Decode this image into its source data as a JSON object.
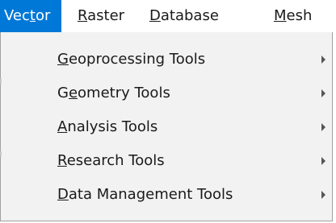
{
  "menubar": {
    "vector": {
      "before": "Vec",
      "mnemonic": "t",
      "after": "or"
    },
    "raster": {
      "before": "",
      "mnemonic": "R",
      "after": "aster"
    },
    "database": {
      "before": "",
      "mnemonic": "D",
      "after": "atabase"
    },
    "mesh": {
      "before": "",
      "mnemonic": "M",
      "after": "esh"
    }
  },
  "vector_menu": {
    "items": [
      {
        "before": "",
        "mnemonic": "G",
        "after": "eoprocessing Tools"
      },
      {
        "before": "G",
        "mnemonic": "e",
        "after": "ometry Tools"
      },
      {
        "before": "",
        "mnemonic": "A",
        "after": "nalysis Tools"
      },
      {
        "before": "",
        "mnemonic": "R",
        "after": "esearch Tools"
      },
      {
        "before": "",
        "mnemonic": "D",
        "after": "ata Management Tools"
      }
    ]
  },
  "colors": {
    "highlight": "#0078d7",
    "menu_background": "#f2f2f2",
    "menu_border": "#a0a0a0"
  },
  "icons": {
    "submenu": "chevron-right-icon"
  }
}
